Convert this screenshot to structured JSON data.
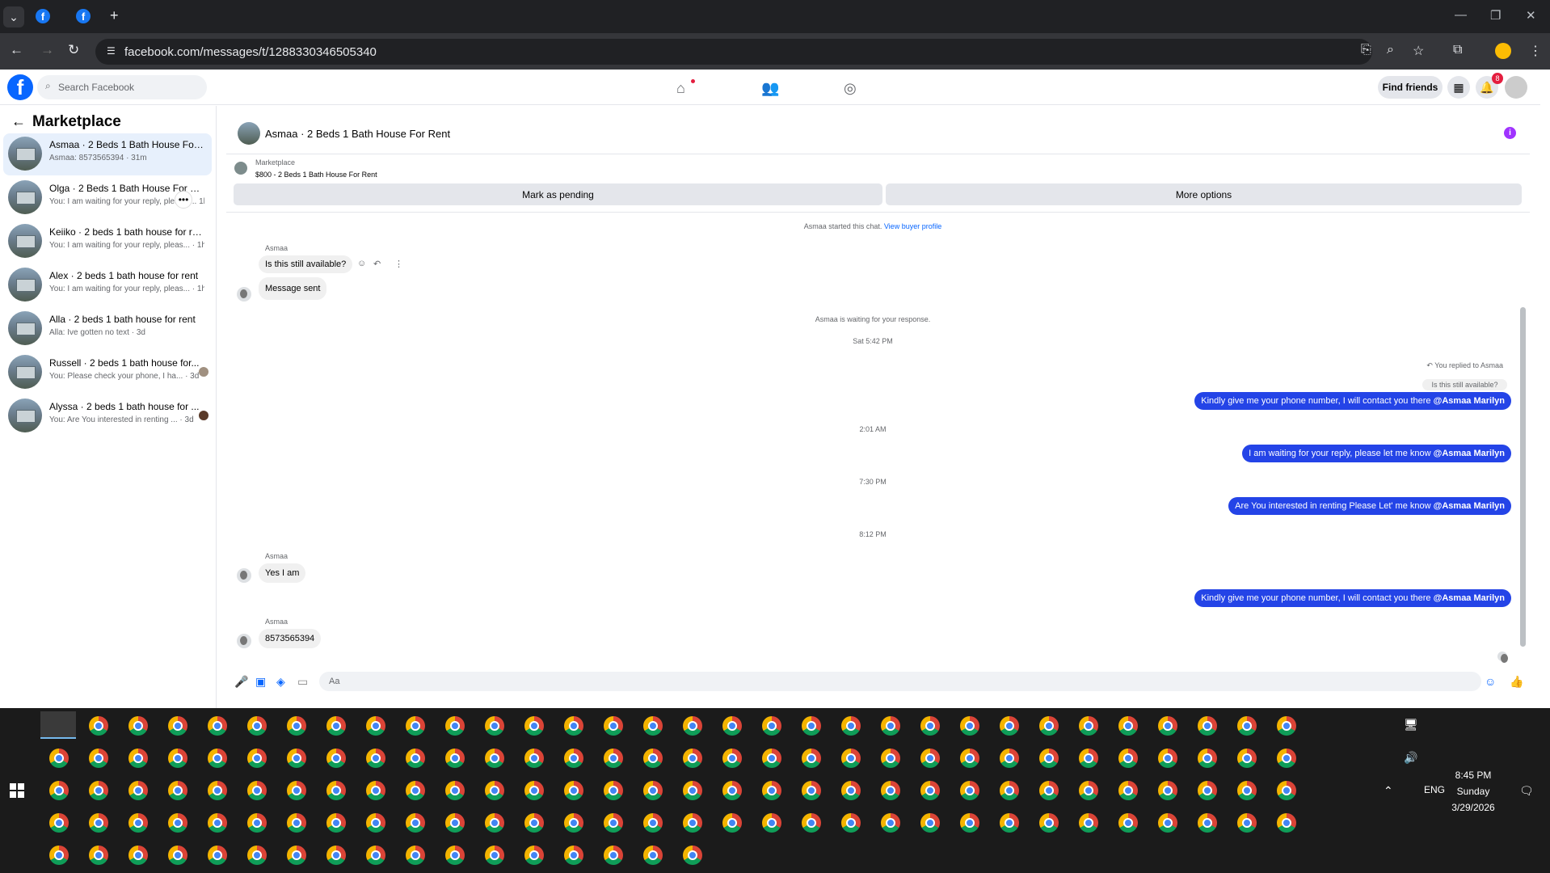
{
  "browser": {
    "url": "facebook.com/messages/t/1288330346505340",
    "new_tab": "+",
    "tab_favicon": "f"
  },
  "header": {
    "logo": "f",
    "search_placeholder": "Search Facebook",
    "find_friends": "Find friends",
    "notification_count": "8"
  },
  "sidebar": {
    "title": "Marketplace",
    "conversations": [
      {
        "title": "Asmaa · 2 Beds 1 Bath House For R...",
        "sub": "Asmaa: 8573565394 · 31m",
        "active": true
      },
      {
        "title": "Olga · 2 Beds 1 Bath House For Rent",
        "sub": "You: I am waiting for your reply, please ... 1h"
      },
      {
        "title": "Keiiko · 2 beds 1 bath house for rent",
        "sub": "You: I am waiting for your reply, pleas... · 1h"
      },
      {
        "title": "Alex · 2 beds 1 bath house for rent",
        "sub": "You: I am waiting for your reply, pleas... · 1h"
      },
      {
        "title": "Alla · 2 beds 1 bath house for rent",
        "sub": "Alla: Ive gotten no text · 3d"
      },
      {
        "title": "Russell · 2 beds 1 bath house for...",
        "sub": "You: Please check your phone, I ha... · 3d"
      },
      {
        "title": "Alyssa · 2 beds 1 bath house for ...",
        "sub": "You: Are You interested in renting ... · 3d"
      }
    ]
  },
  "chat": {
    "title": "Asmaa · 2 Beds 1 Bath House For Rent",
    "listing_label": "Marketplace",
    "listing_detail": "$800 - 2 Beds 1 Bath House For Rent",
    "mark_pending": "Mark as pending",
    "more_options": "More options",
    "started_text": "Asmaa started this chat.",
    "view_profile": "View buyer profile",
    "sender_name": "Asmaa",
    "msg1": "Is this still available?",
    "msg2": "Message sent",
    "waiting": "Asmaa is waiting for your response.",
    "time1": "Sat 5:42 PM",
    "replied_to": "You replied to Asmaa",
    "quoted": "Is this still available?",
    "out1": "Kindly give me your phone number, I will contact you there ",
    "out2": "I am waiting for your reply, please let me know ",
    "out3": "Are You  interested in renting Please Let' me know ",
    "out4": "Kindly give me your phone number, I will contact you there ",
    "mention": "@Asmaa Marilyn",
    "time2": "2:01 AM",
    "time3": "7:30 PM",
    "time4": "8:12 PM",
    "in3": "Yes I am",
    "in4": "8573565394",
    "composer_placeholder": "Aa"
  },
  "taskbar": {
    "lang": "ENG",
    "time": "8:45 PM",
    "day": "Sunday",
    "date": "3/29/2026"
  },
  "colors": {
    "fb_blue": "#0866ff",
    "bubble_out": "#2444e7",
    "badge_red": "#e41e3f"
  }
}
